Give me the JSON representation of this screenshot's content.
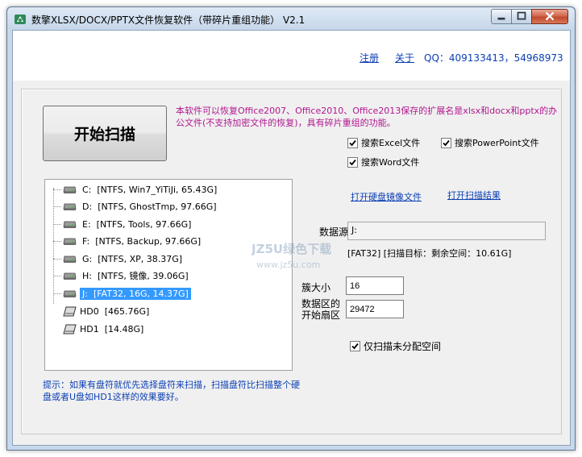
{
  "window": {
    "title": "数擎XLSX/DOCX/PPTX文件恢复软件（带碎片重组功能） V2.1"
  },
  "header": {
    "register_label": "注册",
    "about_label": "关于",
    "qq_text": "QQ：409133413，54968973"
  },
  "scan_button_label": "开始扫描",
  "description": "本软件可以恢复Office2007、Office2010、Office2013保存的扩展名是xlsx和docx和pptx的办公文件(不支持加密文件的恢复)，具有碎片重组的功能。",
  "options": {
    "excel_label": "搜索Excel文件",
    "powerpoint_label": "搜索PowerPoint文件",
    "word_label": "搜索Word文件",
    "unallocated_label": "仅扫描未分配空间"
  },
  "drives": [
    {
      "letter": "C:",
      "info": "[NTFS, Win7_YiTiJi, 65.43G]"
    },
    {
      "letter": "D:",
      "info": "[NTFS, GhostTmp, 97.66G]"
    },
    {
      "letter": "E:",
      "info": "[NTFS, Tools, 97.66G]"
    },
    {
      "letter": "F:",
      "info": "[NTFS, Backup, 97.66G]"
    },
    {
      "letter": "G:",
      "info": "[NTFS, XP, 38.37G]"
    },
    {
      "letter": "H:",
      "info": "[NTFS, 镜像, 39.06G]"
    },
    {
      "letter": "J:",
      "info": "[FAT32, 16G, 14.37G]"
    }
  ],
  "disks": [
    {
      "name": "HD0",
      "info": "[465.76G]"
    },
    {
      "name": "HD1",
      "info": "[14.48G]"
    }
  ],
  "links": {
    "open_image": "打开硬盘镜像文件",
    "open_results": "打开扫描结果"
  },
  "source": {
    "label": "数据源",
    "value": "J:",
    "status": "[FAT32]  [扫描目标：剩余空间：10.61G]"
  },
  "cluster": {
    "label": "簇大小",
    "value": "16"
  },
  "start_sector": {
    "label_line1": "数据区的",
    "label_line2": "开始扇区",
    "value": "29472"
  },
  "hint": "提示：如果有盘符就优先选择盘符来扫描，扫描盘符比扫描整个硬盘或者U盘如HD1这样的效果要好。",
  "watermark": {
    "line1": "JZ5U绿色下载",
    "line2": "www.jz5u.com"
  },
  "colors": {
    "link": "#0b3fb4",
    "description": "#b0178f",
    "selection": "#3399ff"
  }
}
